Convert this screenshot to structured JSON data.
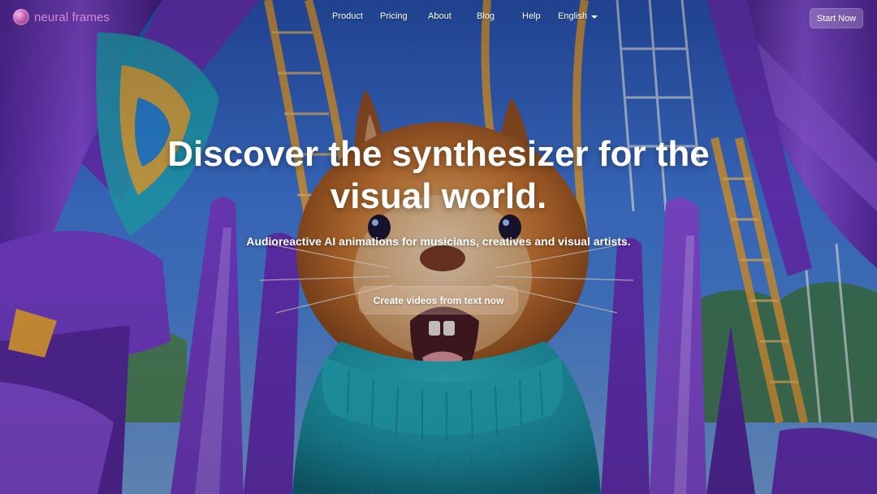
{
  "brand": {
    "name": "neural frames",
    "logo_icon": "neural-frames-logo-icon",
    "color": "#d489d8"
  },
  "nav": {
    "items": [
      {
        "label": "Product"
      },
      {
        "label": "Pricing"
      },
      {
        "label": "About"
      },
      {
        "label": "Blog"
      },
      {
        "label": "Help"
      }
    ],
    "language": {
      "label": "English",
      "icon": "chevron-down-icon"
    },
    "start_button": {
      "label": "Start Now"
    }
  },
  "hero": {
    "title": "Discover the synthesizer for the visual world.",
    "subtitle": "Audioreactive AI animations for musicians, creatives and visual artists.",
    "cta_label": "Create videos from text now"
  },
  "colors": {
    "sky": "#3b6fd6",
    "ride_purple": "#7a3fd0",
    "track_orange": "#e6a33a",
    "sweater_teal": "#1fa6b5",
    "fur_orange": "#c9742e"
  }
}
